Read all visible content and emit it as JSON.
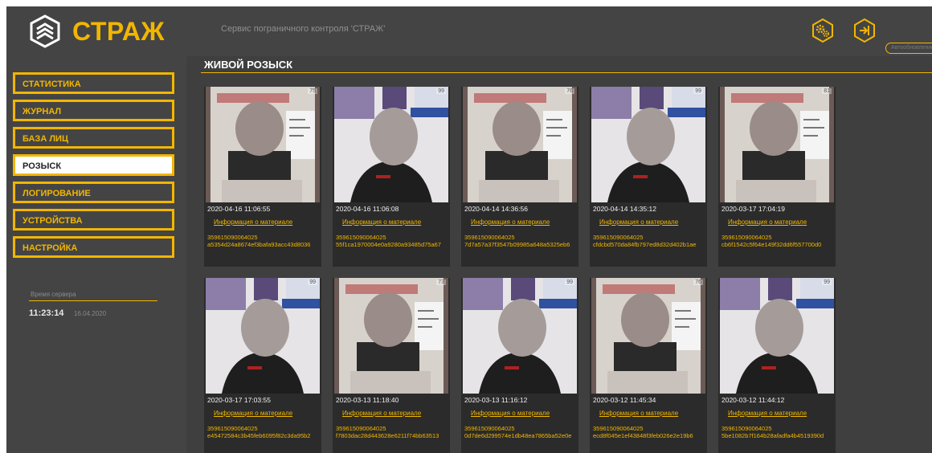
{
  "app": {
    "brand": "СТРАЖ",
    "service_title": "Сервис пограничного контроля 'СТРАЖ'",
    "search_placeholder": "Автообновление",
    "accent_color": "#f2b600"
  },
  "nav": [
    {
      "label": "СТАТИСТИКА",
      "active": false
    },
    {
      "label": "ЖУРНАЛ",
      "active": false
    },
    {
      "label": "БАЗА ЛИЦ",
      "active": false
    },
    {
      "label": "РОЗЫСК",
      "active": true
    },
    {
      "label": "ЛОГИРОВАНИЕ",
      "active": false
    },
    {
      "label": "УСТРОЙСТВА",
      "active": false
    },
    {
      "label": "НАСТРОЙКА",
      "active": false
    }
  ],
  "server": {
    "label": "Время сервера",
    "time": "11:23:14",
    "date": "16.04.2020"
  },
  "section": {
    "title": "ЖИВОЙ РОЗЫСК"
  },
  "cards": [
    {
      "score": "75",
      "date": "2020-04-16 11:06:55",
      "info": "Информация о материале",
      "device": "359615090064025",
      "hash": "a5354d24a8674ef3bafa93acc43d8036",
      "photo": "document"
    },
    {
      "score": "99",
      "date": "2020-04-16 11:06:08",
      "info": "Информация о материале",
      "device": "359615090064025",
      "hash": "55f1ca1970004e0a9280a93485d75a67",
      "photo": "person"
    },
    {
      "score": "76",
      "date": "2020-04-14 14:36:56",
      "info": "Информация о материале",
      "device": "359615090064025",
      "hash": "7d7a57a37f3547b09985a648a5325eb6",
      "photo": "document"
    },
    {
      "score": "99",
      "date": "2020-04-14 14:35:12",
      "info": "Информация о материале",
      "device": "359615090064025",
      "hash": "cfdcbd570da84fb797ed8d32d402b1ae",
      "photo": "person"
    },
    {
      "score": "81",
      "date": "2020-03-17 17:04:19",
      "info": "Информация о материале",
      "device": "359615090064025",
      "hash": "cb6f1542c5f64e149f32dd6f557700d0",
      "photo": "document"
    },
    {
      "score": "99",
      "date": "2020-03-17 17:03:55",
      "info": "Информация о материале",
      "device": "359615090064025",
      "hash": "e45472584c3b45feb6095f82c3da95b2",
      "photo": "person"
    },
    {
      "score": "73",
      "date": "2020-03-13 11:18:40",
      "info": "Информация о материале",
      "device": "359615090064025",
      "hash": "f7803dac28d443628e6211f74bb63513",
      "photo": "document"
    },
    {
      "score": "99",
      "date": "2020-03-13 11:16:12",
      "info": "Информация о материале",
      "device": "359615090064025",
      "hash": "0d7de6d299574e1db48ea7865ba52e0e",
      "photo": "person"
    },
    {
      "score": "76",
      "date": "2020-03-12 11:45:34",
      "info": "Информация о материале",
      "device": "359615090064025",
      "hash": "ecd8f045e1ef43848f3feb026e2e19b6",
      "photo": "document"
    },
    {
      "score": "99",
      "date": "2020-03-12 11:44:12",
      "info": "Информация о материале",
      "device": "359615090064025",
      "hash": "5be1082b7f164b28afadfa4b4519390d",
      "photo": "person"
    }
  ]
}
